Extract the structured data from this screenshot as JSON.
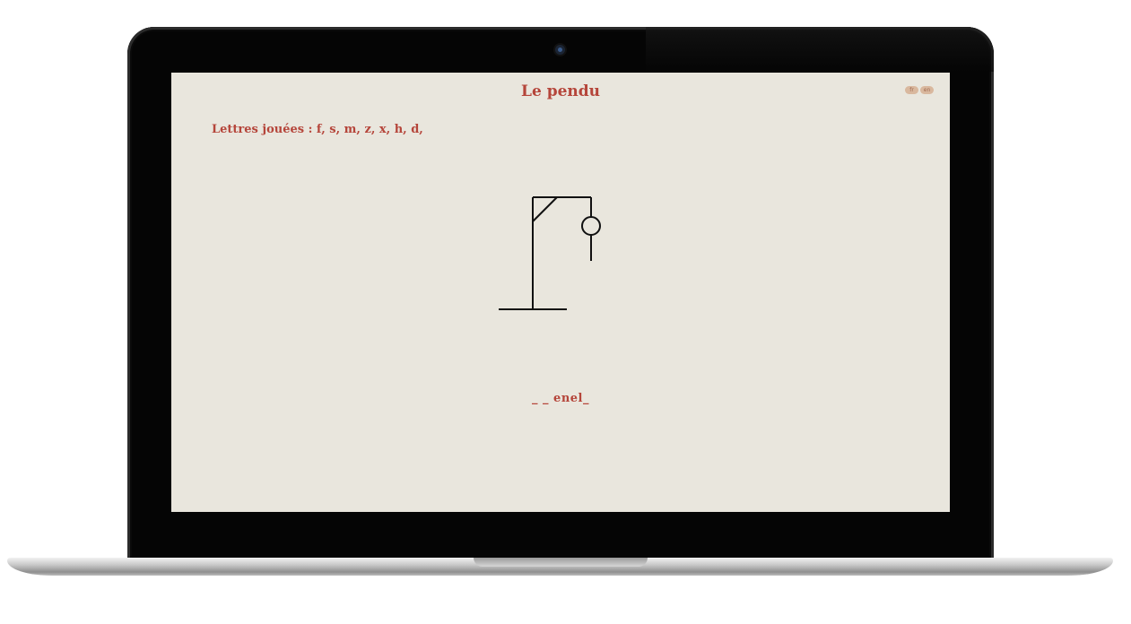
{
  "app": {
    "title": "Le pendu",
    "languages": [
      "fr",
      "en"
    ]
  },
  "played_letters_text": "Lettres jouées : f, s, m, z, x, h, d,",
  "hidden_word": "_ _ enel_"
}
